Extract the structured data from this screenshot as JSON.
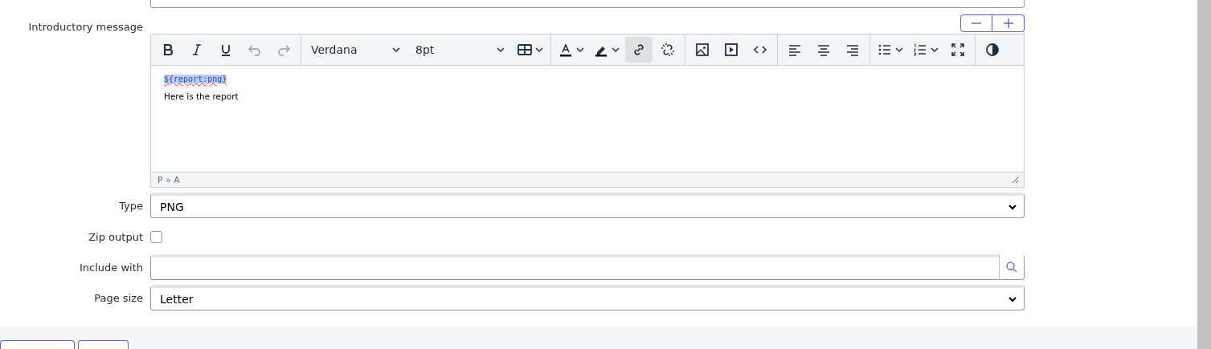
{
  "intro": {
    "label": "Introductory message",
    "toolbar": [
      [
        {
          "kind": "bold",
          "active": false
        },
        {
          "kind": "italic",
          "active": false
        },
        {
          "kind": "underline",
          "active": false
        },
        {
          "kind": "undo",
          "active": false
        },
        {
          "kind": "redo",
          "active": false
        }
      ],
      [
        {
          "kind": "font",
          "text": "Verdana"
        },
        {
          "kind": "size",
          "text": "8pt"
        },
        {
          "kind": "table",
          "active": false
        }
      ],
      [
        {
          "kind": "forecolor",
          "active": false
        },
        {
          "kind": "highlight",
          "active": false
        },
        {
          "kind": "link",
          "active": true
        },
        {
          "kind": "unlink",
          "active": false
        }
      ],
      [
        {
          "kind": "image",
          "active": false
        },
        {
          "kind": "media",
          "active": false
        },
        {
          "kind": "code",
          "active": false
        }
      ],
      [
        {
          "kind": "alignleft",
          "active": false
        },
        {
          "kind": "aligncenter",
          "active": false
        },
        {
          "kind": "alignright",
          "active": false
        }
      ],
      [
        {
          "kind": "bullist",
          "active": false
        },
        {
          "kind": "numlist",
          "active": false
        },
        {
          "kind": "fullscreen",
          "active": false
        }
      ],
      [
        {
          "kind": "contrast",
          "active": false
        }
      ]
    ],
    "content": [
      {
        "text": "${report:png}",
        "highlighted": true
      },
      {
        "text": "Here is the report",
        "highlighted": false
      }
    ],
    "path": "P » A"
  },
  "fields": [
    {
      "kind": "select",
      "label": "Type",
      "value": "PNG"
    },
    {
      "kind": "checkbox",
      "label": "Zip output",
      "checked": false
    },
    {
      "kind": "lookup",
      "label": "Include with"
    },
    {
      "kind": "select",
      "label": "Page size",
      "value": "Letter"
    }
  ]
}
